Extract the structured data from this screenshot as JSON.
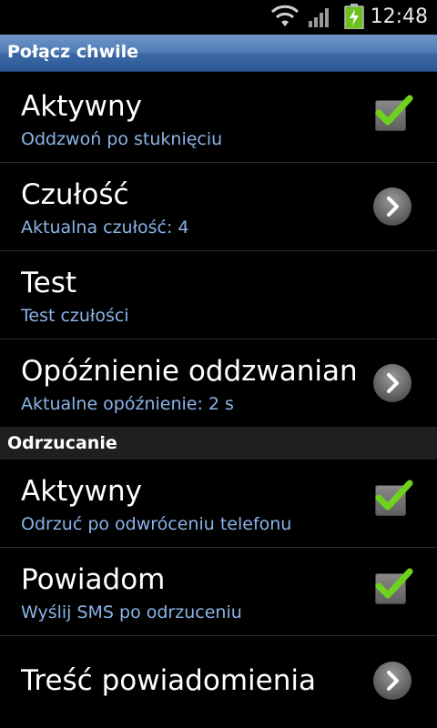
{
  "status_bar": {
    "time": "12:48",
    "icons": [
      "wifi-icon",
      "signal-icon",
      "battery-charging-icon"
    ]
  },
  "title_bar": {
    "title": "Połącz chwile"
  },
  "sections": [
    {
      "items": [
        {
          "title": "Aktywny",
          "subtitle": "Oddzwoń po stuknięciu",
          "control": "checkbox",
          "checked": true
        },
        {
          "title": "Czułość",
          "subtitle": "Aktualna czułość: 4",
          "control": "chevron-right-icon"
        },
        {
          "title": "Test",
          "subtitle": "Test czułości",
          "control": "none"
        },
        {
          "title": "Opóźnienie oddzwaniania",
          "subtitle": "Aktualne opóźnienie: 2 s",
          "control": "chevron-right-icon"
        }
      ]
    },
    {
      "header": "Odrzucanie",
      "items": [
        {
          "title": "Aktywny",
          "subtitle": "Odrzuć po odwróceniu telefonu",
          "control": "checkbox",
          "checked": true
        },
        {
          "title": "Powiadom",
          "subtitle": "Wyślij SMS po odrzuceniu",
          "control": "checkbox",
          "checked": true
        },
        {
          "title": "Treść powiadomienia",
          "subtitle": "",
          "control": "chevron-right-icon"
        }
      ]
    }
  ],
  "colors": {
    "subtitle": "#8ab4e8",
    "title_bar": "#4f7cb6",
    "check": "#6fd21e",
    "section_header_bg": "#1f1f1f"
  }
}
